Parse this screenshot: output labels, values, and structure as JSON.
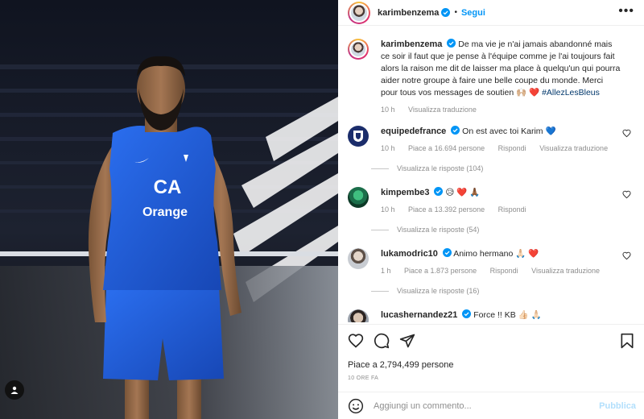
{
  "post": {
    "author": "karimbenzema",
    "follow_label": "Segui",
    "more_label": "•••",
    "caption_username": "karimbenzema",
    "caption_text": "De ma vie je n'ai jamais abandonné mais ce soir il faut que je pense à l'équipe comme je l'ai toujours fait alors la raison me dit de laisser ma place à quelqu'un qui pourra aider notre groupe à faire une belle coupe du monde. Merci pour tous vos messages de soutien 🙌🏼 ❤️",
    "caption_hashtag": "#AllezLesBleus",
    "caption_time": "10 h",
    "caption_translate": "Visualizza traduzione",
    "photo_shirt_text_1": "CA",
    "photo_shirt_text_2": "Orange"
  },
  "comments": [
    {
      "username": "equipedefrance",
      "text": "On est avec toi Karim 💙",
      "time": "10 h",
      "likes": "Piace a 16.694 persone",
      "reply": "Rispondi",
      "translate": "Visualizza traduzione",
      "replies": "Visualizza le risposte (104)"
    },
    {
      "username": "kimpembe3",
      "text": "😥 ❤️ 🙏🏾",
      "time": "10 h",
      "likes": "Piace a 13.392 persone",
      "reply": "Rispondi",
      "replies": "Visualizza le risposte (54)"
    },
    {
      "username": "lukamodric10",
      "text": "Animo hermano 🙏🏻 ❤️",
      "time": "1 h",
      "likes": "Piace a 1.873 persone",
      "reply": "Rispondi",
      "translate": "Visualizza traduzione",
      "replies": "Visualizza le risposte (16)"
    },
    {
      "username": "lucashernandez21",
      "text": "Force !! KB 👍🏻 🙏🏻"
    }
  ],
  "actions": {
    "likes_text": "Piace a 2,794,499 persone",
    "time_text": "10 ORE FA",
    "comment_placeholder": "Aggiungi un commento...",
    "publish_label": "Pubblica"
  },
  "colors": {
    "accent": "#0095f6",
    "verified": "#0095f6",
    "muted": "#8e8e8e",
    "jersey": "#1f5fd6",
    "heart": "#ed4956"
  },
  "icons": [
    "verified-icon",
    "more-icon",
    "heart-icon",
    "comment-icon",
    "share-icon",
    "bookmark-icon",
    "emoji-icon",
    "tag-user-icon"
  ]
}
